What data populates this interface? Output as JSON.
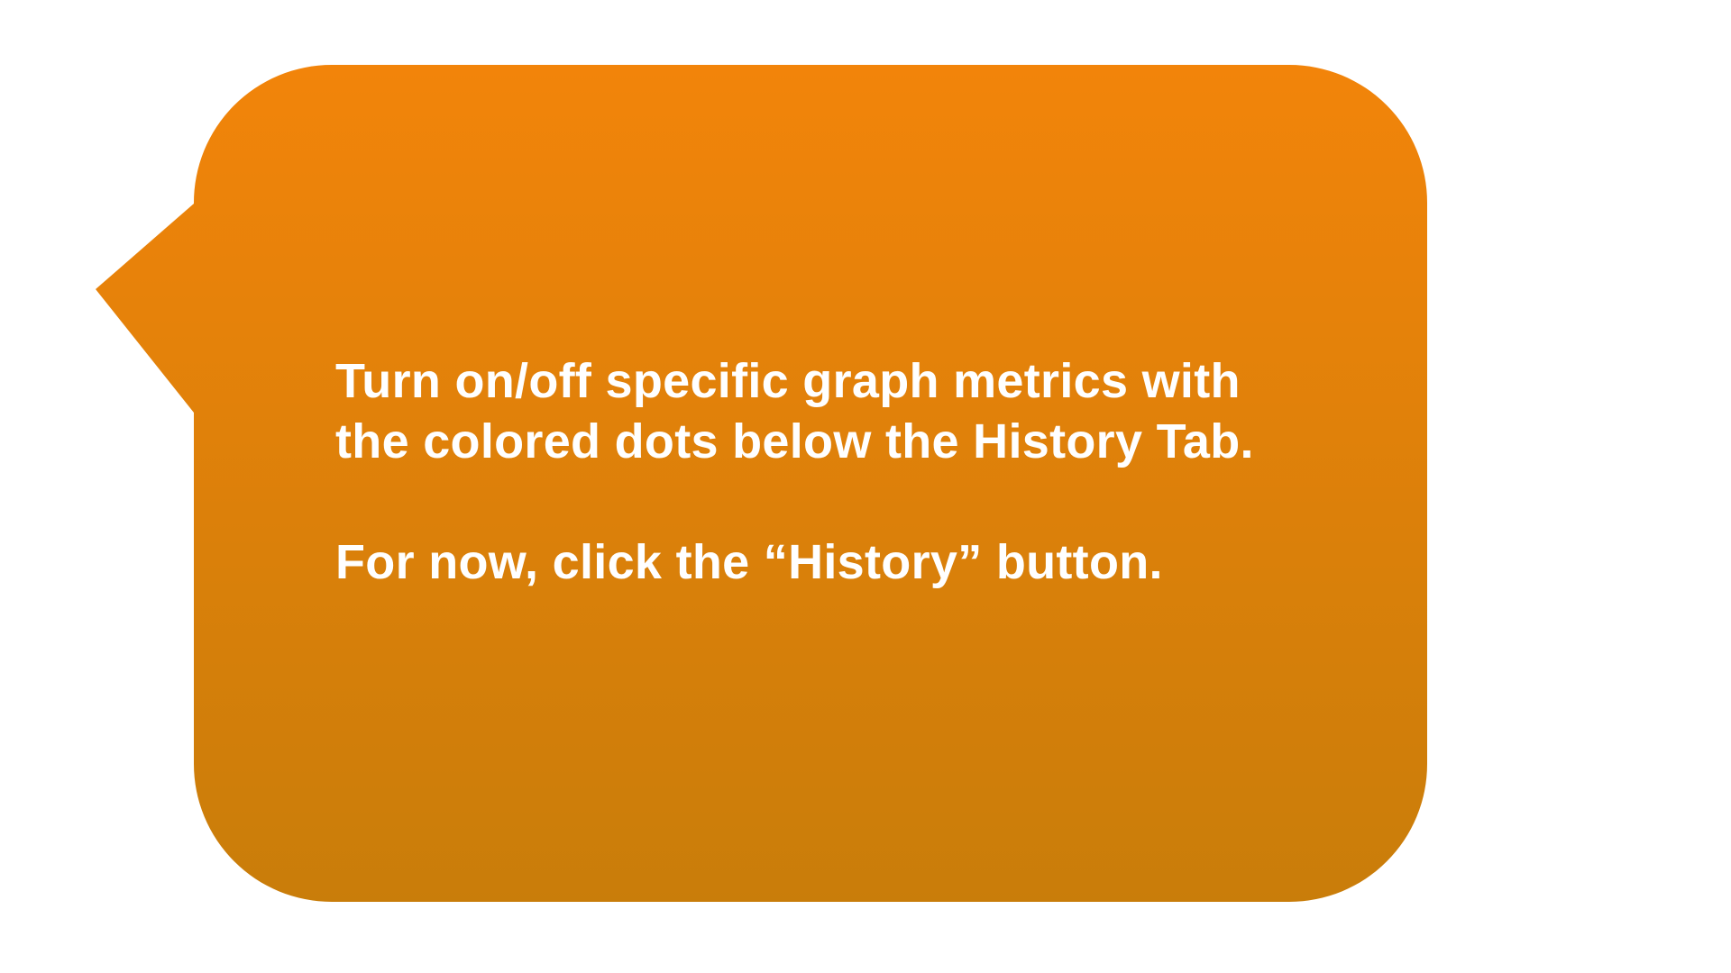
{
  "tooltip": {
    "line1": "Turn on/off specific graph metrics with",
    "line2": "the colored dots below the History Tab.",
    "line3": "For now, click the “History” button.",
    "gradient_top": "#F2840A",
    "gradient_bottom": "#C97D0A"
  }
}
